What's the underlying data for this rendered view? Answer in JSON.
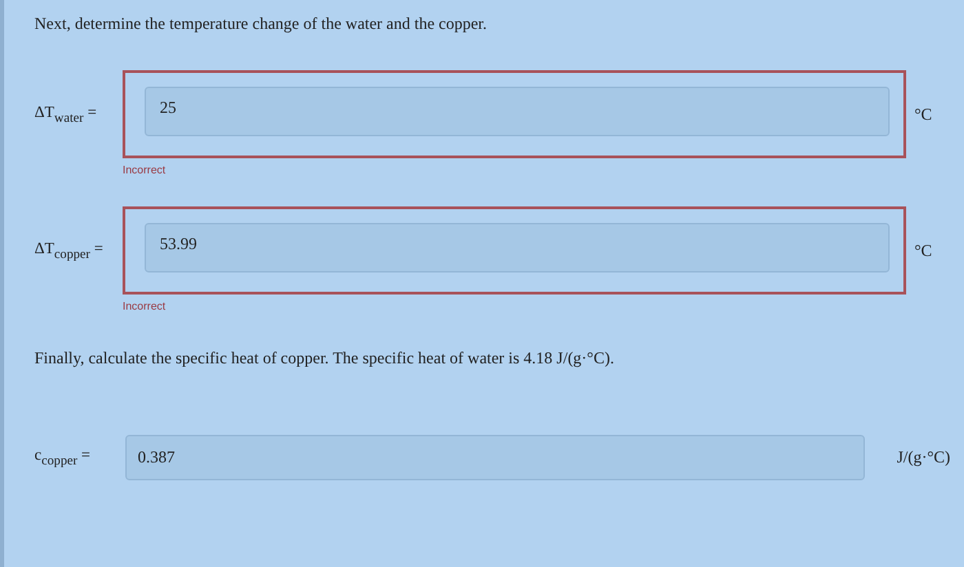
{
  "intro": "Next, determine the temperature change of the water and the copper.",
  "answers_1": [
    {
      "label": "ΔT$_{water}$ =",
      "value": "25",
      "unit": "°C",
      "incorrect": true,
      "feedback": "Incorrect"
    },
    {
      "label": "ΔT$_{copper}$ =",
      "value": "53.99",
      "unit": "°C",
      "incorrect": true,
      "feedback": "Incorrect"
    }
  ],
  "prompt": "Finally, calculate the specific heat of copper. The specific heat of water is 4.18 J/(g·°C).",
  "answers_2": [
    {
      "label": "c$_{copper}$ =",
      "value": "0.387",
      "unit": "J/(g·°C)",
      "incorrect": false
    }
  ]
}
